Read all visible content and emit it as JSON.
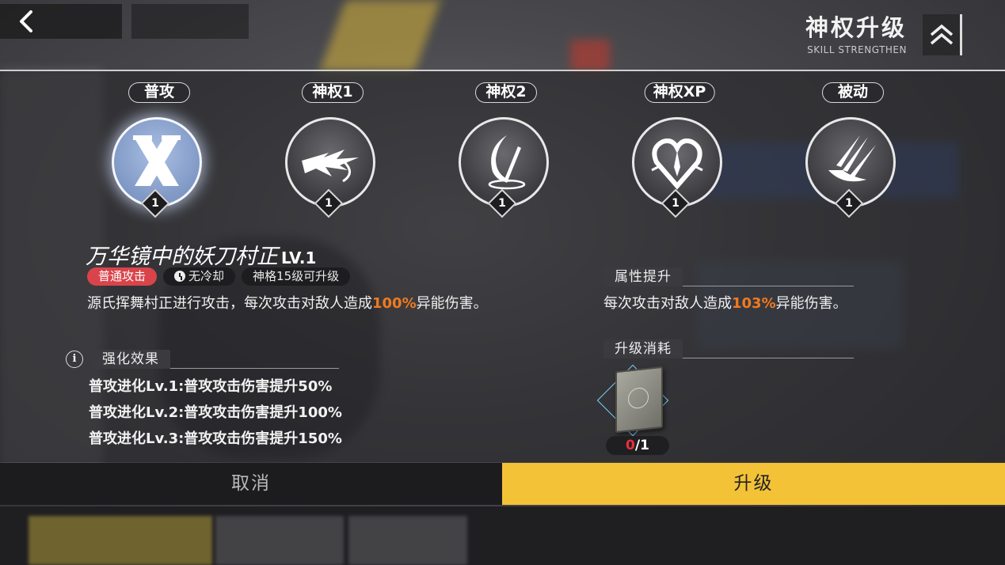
{
  "header": {
    "title": "神权升级",
    "subtitle": "SKILL STRENGTHEN",
    "back_icon": "chevron-left-icon",
    "rank_icon": "double-chevron-up-icon"
  },
  "skills": [
    {
      "label": "普攻",
      "level": "1",
      "icon": "crossed-blades-icon",
      "active": true
    },
    {
      "label": "神权1",
      "level": "1",
      "icon": "dash-slash-icon",
      "active": false
    },
    {
      "label": "神权2",
      "level": "1",
      "icon": "crescent-sword-icon",
      "active": false
    },
    {
      "label": "神权XP",
      "level": "1",
      "icon": "heart-flame-icon",
      "active": false
    },
    {
      "label": "被动",
      "level": "1",
      "icon": "claw-strike-icon",
      "active": false
    }
  ],
  "detail": {
    "name": "万华镜中的妖刀村正",
    "level": "LV.1",
    "tags": {
      "type": "普通攻击",
      "cooldown": "无冷却",
      "requirement": "神格15级可升级"
    },
    "desc_before": "源氏挥舞村正进行攻击，每次攻击对敌人造成",
    "desc_value": "100%",
    "desc_after": "异能伤害。",
    "enhance_title": "强化效果",
    "evolutions": [
      {
        "label": "普攻进化",
        "lv": "Lv.1",
        "text": ":普攻攻击伤害提升50%"
      },
      {
        "label": "普攻进化",
        "lv": "Lv.2",
        "text": ":普攻攻击伤害提升100%"
      },
      {
        "label": "普攻进化",
        "lv": "Lv.3",
        "text": ":普攻攻击伤害提升150%"
      }
    ]
  },
  "upgrade": {
    "attr_title": "属性提升",
    "attr_before": "每次攻击对敌人造成",
    "attr_value": "103%",
    "attr_after": "异能伤害。",
    "cost_title": "升级消耗",
    "cost_have": "0",
    "cost_need": "/1",
    "cost_item_icon": "skill-book-icon"
  },
  "buttons": {
    "cancel": "取消",
    "confirm": "升级"
  },
  "colors": {
    "accent_yellow": "#f3c236",
    "highlight_orange": "#f07a1e",
    "tag_red": "#d9444b",
    "count_red": "#e8303a"
  }
}
